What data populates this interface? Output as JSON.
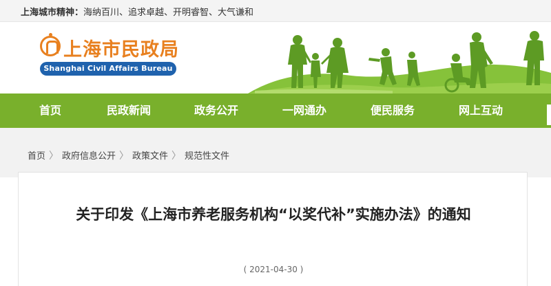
{
  "topbar": {
    "motto_label": "上海城市精神：",
    "motto_text": "海纳百川、追求卓越、开明睿智、大气谦和"
  },
  "logo": {
    "cn_name": "上海市民政局",
    "en_name": "Shanghai Civil Affairs Bureau"
  },
  "nav": {
    "items": [
      {
        "label": "首页"
      },
      {
        "label": "民政新闻"
      },
      {
        "label": "政务公开"
      },
      {
        "label": "一网通办"
      },
      {
        "label": "便民服务"
      },
      {
        "label": "网上互动"
      }
    ]
  },
  "breadcrumb": {
    "items": [
      {
        "label": "首页"
      },
      {
        "label": "政府信息公开"
      },
      {
        "label": "政策文件"
      },
      {
        "label": "规范性文件"
      }
    ],
    "separator": "〉"
  },
  "article": {
    "title": "关于印发《上海市养老服务机构“以奖代补”实施办法》的通知",
    "date": "( 2021-04-30 )"
  },
  "colors": {
    "nav_green": "#79b02c",
    "logo_orange": "#e8801f",
    "logo_blue": "#1f62ad"
  }
}
